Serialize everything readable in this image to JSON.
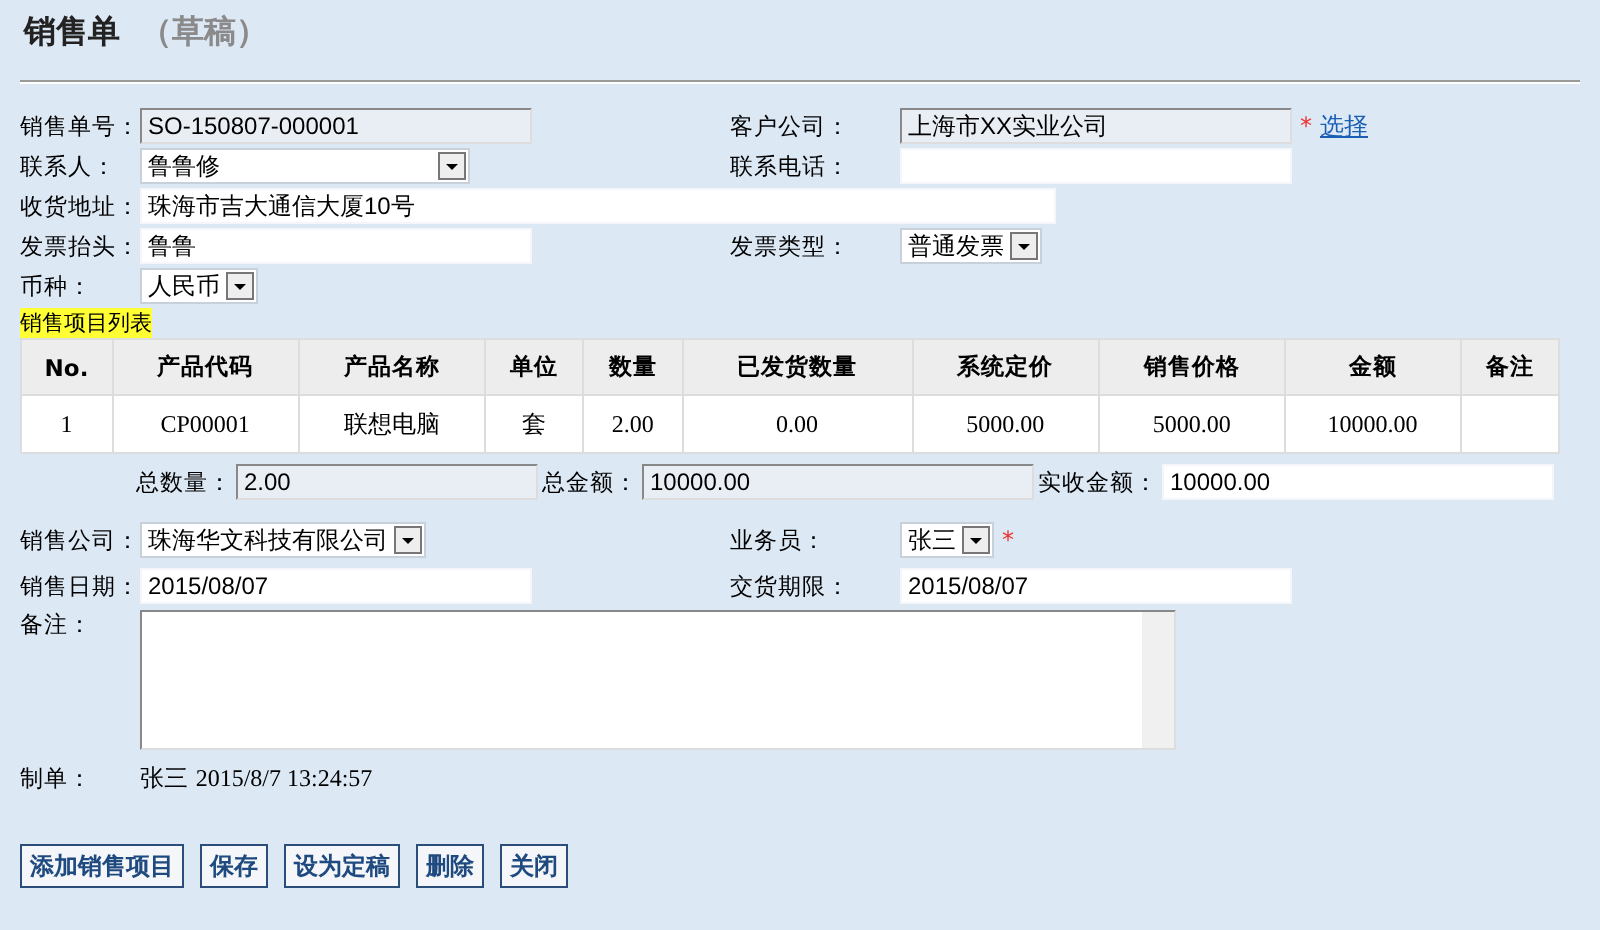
{
  "header": {
    "title": "销售单",
    "status": "（草稿）"
  },
  "top_rows": [
    {
      "left": {
        "label": "销售单号：",
        "value": "SO-150807-000001",
        "kind": "readonly"
      },
      "right": {
        "label": "客户公司：",
        "value": "上海市XX实业公司",
        "kind": "readonly",
        "required_mark": "*",
        "link": "选择"
      }
    },
    {
      "left": {
        "label": "联系人：",
        "value": "鲁鲁修",
        "kind": "select"
      },
      "right": {
        "label": "联系电话：",
        "kind": "text"
      }
    },
    {
      "left": {
        "label": "收货地址：",
        "value": "珠海市吉大通信大厦10号",
        "kind": "wide"
      }
    },
    {
      "left": {
        "label": "发票抬头：",
        "value": "鲁鲁",
        "kind": "text"
      },
      "right": {
        "label": "发票类型：",
        "value": "普通发票",
        "kind": "select"
      }
    },
    {
      "left": {
        "label": "币种：",
        "value": "人民币",
        "kind": "select"
      }
    }
  ],
  "items_title": "销售项目列表",
  "table": {
    "columns": [
      "No.",
      "产品代码",
      "产品名称",
      "单位",
      "数量",
      "已发货数量",
      "系统定价",
      "销售价格",
      "金额",
      "备注"
    ],
    "rows": [
      [
        "1",
        "CP00001",
        "联想电脑",
        "套",
        "2.00",
        "0.00",
        "5000.00",
        "5000.00",
        "10000.00",
        ""
      ]
    ]
  },
  "totals": [
    {
      "label": "总数量：",
      "value": "2.00",
      "kind": "readonly"
    },
    {
      "label": "总金额：",
      "value": "10000.00",
      "kind": "readonly"
    },
    {
      "label": "实收金额：",
      "value": "10000.00",
      "kind": "text"
    }
  ],
  "bottom_rows": [
    {
      "left": {
        "label": "销售公司：",
        "value": "珠海华文科技有限公司",
        "kind": "select"
      },
      "right": {
        "label": "业务员：",
        "value": "张三",
        "kind": "select",
        "required_mark": "*"
      }
    },
    {
      "left": {
        "label": "销售日期：",
        "value": "2015/08/07",
        "kind": "text"
      },
      "right": {
        "label": "交货期限：",
        "value": "2015/08/07",
        "kind": "text"
      }
    }
  ],
  "notes": {
    "label": "备注："
  },
  "creator": {
    "label": "制单：",
    "name": "张三",
    "time": "2015/8/7 13:24:57"
  },
  "buttons": [
    "添加销售项目",
    "保存",
    "设为定稿",
    "删除",
    "关闭"
  ]
}
